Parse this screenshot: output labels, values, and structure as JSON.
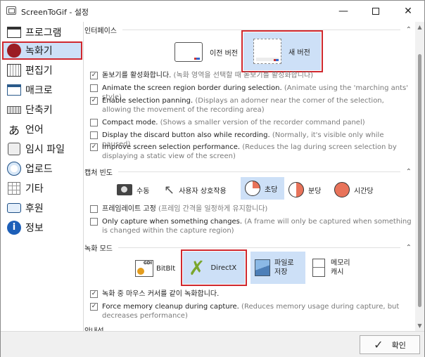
{
  "window": {
    "title": "ScreenToGif - 설정"
  },
  "sidebar": {
    "items": [
      {
        "label": "프로그램",
        "icon": "window-icon"
      },
      {
        "label": "녹화기",
        "icon": "record-icon"
      },
      {
        "label": "편집기",
        "icon": "editor-icon"
      },
      {
        "label": "매크로",
        "icon": "macro-icon"
      },
      {
        "label": "단축키",
        "icon": "keyboard-icon"
      },
      {
        "label": "언어",
        "icon": "language-icon"
      },
      {
        "label": "임시 파일",
        "icon": "temp-files-icon"
      },
      {
        "label": "업로드",
        "icon": "globe-icon"
      },
      {
        "label": "기타",
        "icon": "grid-icon"
      },
      {
        "label": "후원",
        "icon": "donate-icon"
      },
      {
        "label": "정보",
        "icon": "info-icon"
      }
    ]
  },
  "interface": {
    "title": "인터페이스",
    "old_label": "이전 버전",
    "new_label": "새 버전",
    "options": [
      {
        "label": "돋보기를 활성화합니다.",
        "desc": "(녹화 영역을 선택할 때 돋보기를 활성화합니다)",
        "checked": "✓"
      },
      {
        "label": "Animate the screen region border during selection.",
        "desc": "(Animate using the 'marching ants' style)",
        "checked": ""
      },
      {
        "label": "Enable selection panning.",
        "desc": "(Displays an adorner near the corner of the selection, allowing the movement of the recording area)",
        "checked": "✓"
      },
      {
        "label": "Compact mode.",
        "desc": "(Shows a smaller version of the recorder command panel)",
        "checked": ""
      },
      {
        "label": "Display the discard button also while recording.",
        "desc": "(Normally, it's visible only while paused)",
        "checked": ""
      },
      {
        "label": "Improve screen selection performance.",
        "desc": "(Reduces the lag during screen selection by displaying a static view of the screen)",
        "checked": "✓"
      }
    ]
  },
  "capture_freq": {
    "title": "캡처 빈도",
    "modes": [
      "수동",
      "사용자 상호작용",
      "초당",
      "분당",
      "시간당"
    ],
    "options": [
      {
        "label": "프레임레이트 고정",
        "desc": "(프레임 간격을 일정하게 유지합니다)",
        "checked": ""
      },
      {
        "label": "Only capture when something changes.",
        "desc": "(A frame will only be captured when something is changed within the capture region)",
        "checked": ""
      }
    ]
  },
  "rec_mode": {
    "title": "녹화 모드",
    "bitblt": "BitBlt",
    "gdi": "GDI",
    "directx": "DirectX",
    "file_save": "파일로\n저장",
    "memory_cache": "메모리\n캐시",
    "options": [
      {
        "label": "녹화 중 마우스 커서를 같이 녹화합니다.",
        "desc": "",
        "checked": "✓"
      },
      {
        "label": "Force memory cleanup during capture.",
        "desc": "(Reduces memory usage during capture, but decreases performance)",
        "checked": "✓"
      }
    ]
  },
  "guide": {
    "title": "안내선"
  },
  "footer": {
    "ok_label": "확인"
  }
}
